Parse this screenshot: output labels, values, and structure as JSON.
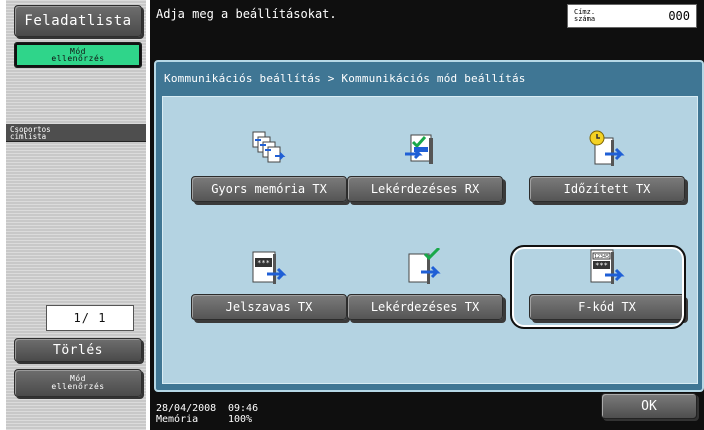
{
  "left_panel": {
    "job_list_button": "Feladatlista",
    "mode_check_top": [
      "Mód",
      "ellenőrzés"
    ],
    "group_list": [
      "Csoportos",
      "címlista"
    ],
    "pager": "1/  1",
    "delete_button": "Törlés",
    "mode_check_bottom": [
      "Mód",
      "ellenőrzés"
    ]
  },
  "header": {
    "prompt": "Adja meg a beállításokat.",
    "address_label": [
      "Címz.",
      "száma"
    ],
    "address_count": "000"
  },
  "panel": {
    "breadcrumb": "Kommunikációs beállítás > Kommunikációs mód beállítás",
    "options": [
      {
        "label": "Gyors memória TX",
        "icon": "quick-memory-tx-icon"
      },
      {
        "label": "Lekérdezéses RX",
        "icon": "polling-rx-icon"
      },
      {
        "label": "Időzített TX",
        "icon": "timer-tx-icon"
      },
      {
        "label": "Jelszavas TX",
        "icon": "password-tx-icon"
      },
      {
        "label": "Lekérdezéses TX",
        "icon": "polling-tx-icon"
      },
      {
        "label": "F-kód TX",
        "icon": "f-code-tx-icon"
      }
    ]
  },
  "footer": {
    "date": "28/04/2008",
    "time": "09:46",
    "memory_label": "Memória",
    "memory_value": "100%",
    "ok_button": "OK"
  },
  "colors": {
    "panel_blue": "#3f7694",
    "panel_inner": "#b4d3e2",
    "mode_check_green": "#2fd58a",
    "arrow_blue": "#1f5fd6"
  }
}
